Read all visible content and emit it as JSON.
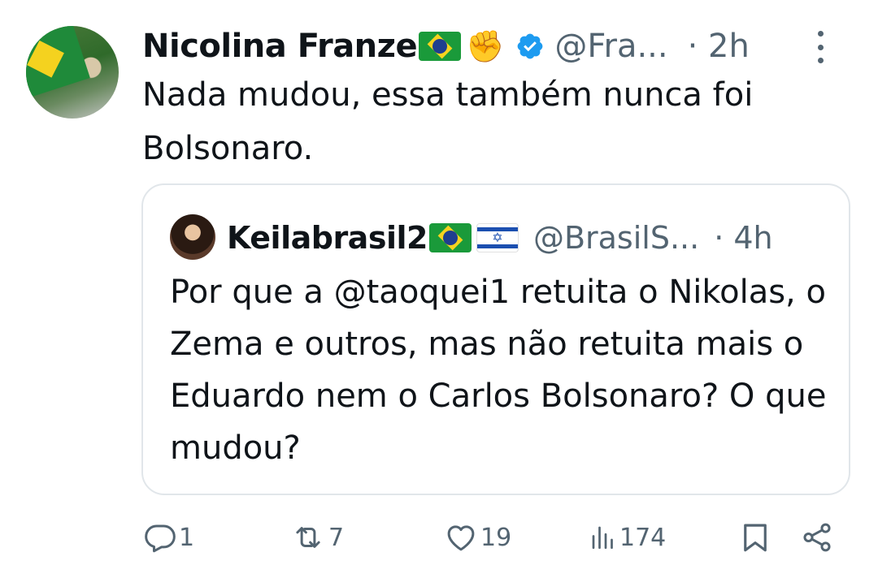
{
  "post": {
    "author_name": "Nicolina Franze",
    "handle": "@Fra...",
    "time": "· 2h",
    "text": "Nada mudou, essa também nunca foi Bolsonaro."
  },
  "quoted": {
    "author_name": "Keilabrasil2",
    "handle": "@BrasilS...",
    "time": "· 4h",
    "text": "Por que a @taoquei1 retuita o Nikolas, o Zema e outros, mas não retuita mais o Eduardo nem o Carlos Bolsonaro? O que mudou?"
  },
  "actions": {
    "replies": "1",
    "reposts": "7",
    "likes": "19",
    "views": "174"
  },
  "colors": {
    "text": "#0f1419",
    "secondary": "#536471",
    "verified": "#1d9bf0",
    "border": "#e1e6ea"
  },
  "icons": [
    "brazil-flag-icon",
    "fist-icon",
    "verified-badge-icon",
    "more-icon",
    "israel-flag-icon",
    "reply-icon",
    "repost-icon",
    "like-icon",
    "views-icon",
    "bookmark-icon",
    "share-icon"
  ]
}
